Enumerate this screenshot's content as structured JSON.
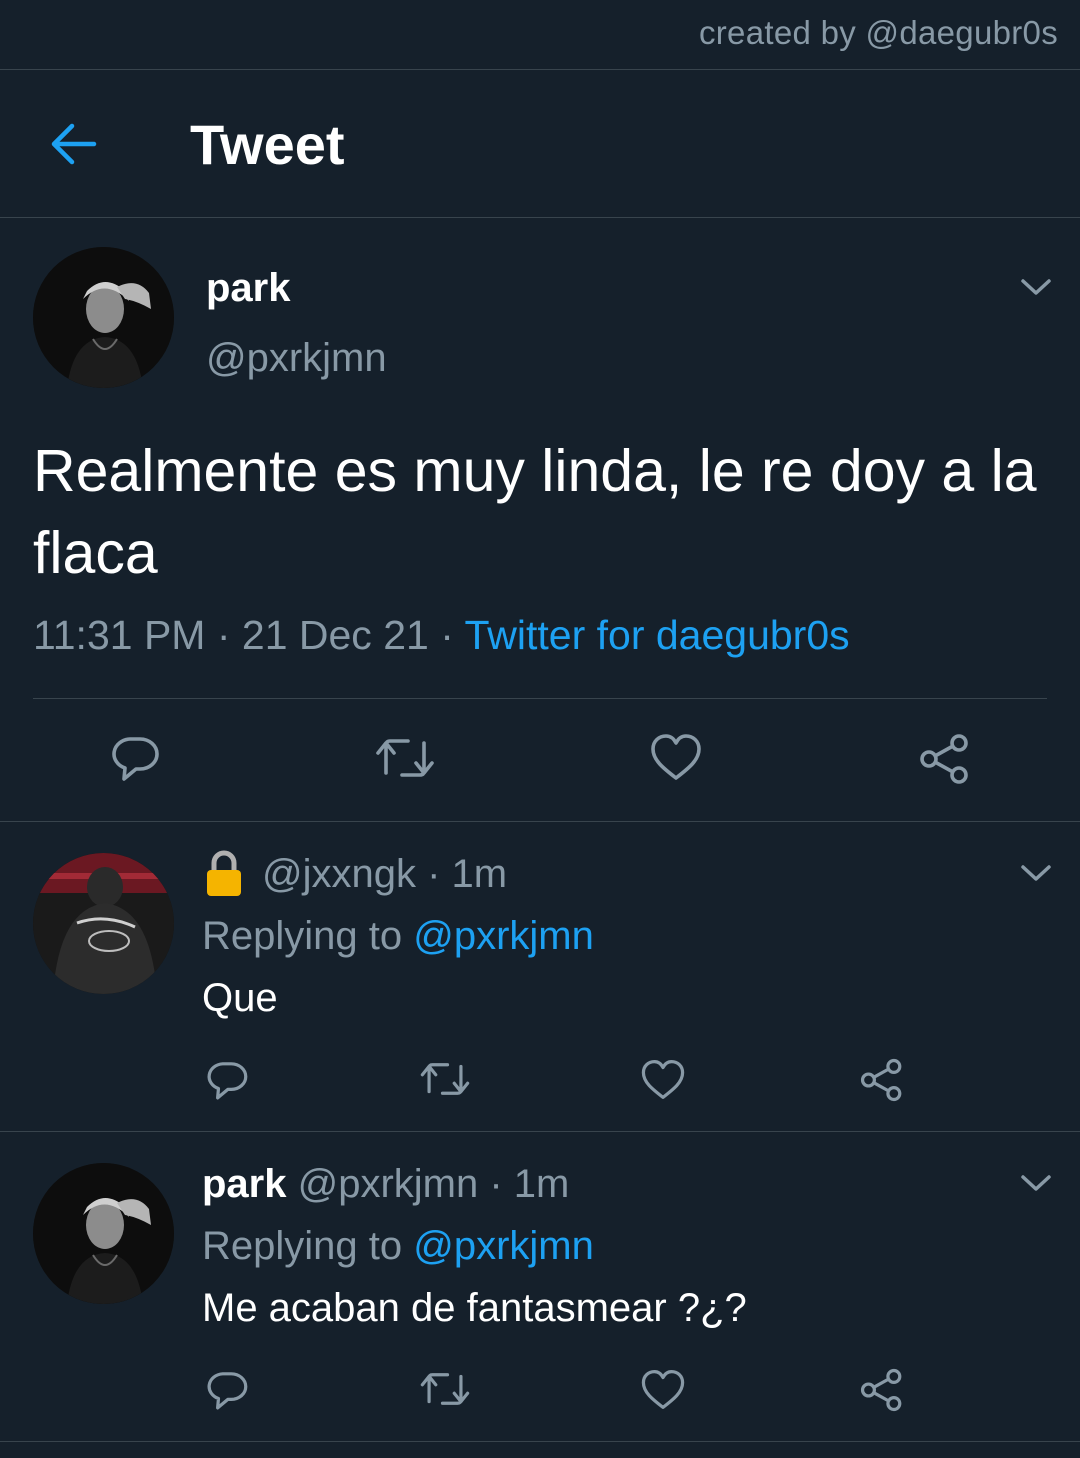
{
  "credit": "created by @daegubr0s",
  "header": {
    "title": "Tweet"
  },
  "tweet": {
    "name": "park",
    "handle": "@pxrkjmn",
    "text": "Realmente es muy linda, le re doy a la flaca",
    "time": "11:31 PM",
    "date": "21 Dec 21",
    "sep": " · ",
    "source": "Twitter for daegubr0s"
  },
  "replies": [
    {
      "handle": "@jxxngk",
      "time": "1m",
      "replying_prefix": "Replying to ",
      "replying_to": "@pxrkjmn",
      "text": "Que",
      "locked": true
    },
    {
      "name": "park",
      "handle": "@pxrkjmn",
      "time": "1m",
      "replying_prefix": "Replying to ",
      "replying_to": "@pxrkjmn",
      "text": "Me acaban de fantasmear ?¿?"
    }
  ],
  "icons": [
    "back-arrow-icon",
    "chevron-down-icon",
    "reply-icon",
    "retweet-icon",
    "like-icon",
    "share-icon",
    "lock-icon"
  ],
  "colors": {
    "background": "#15202b",
    "accent": "#1da1f2",
    "secondary_text": "#8899a6",
    "divider": "#38444d"
  }
}
